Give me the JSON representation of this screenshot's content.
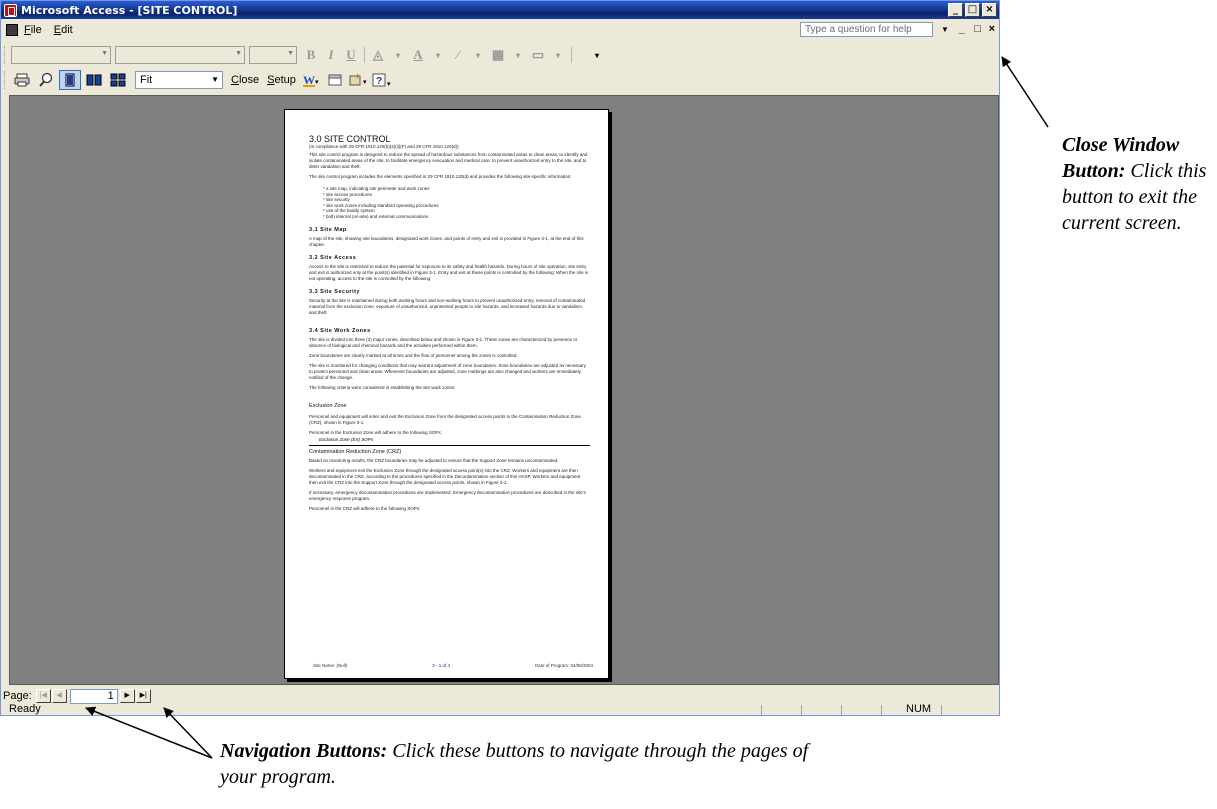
{
  "window": {
    "title": "Microsoft Access - [SITE CONTROL]",
    "minimize": "_",
    "restore": "□",
    "close": "×"
  },
  "menubar": {
    "items": [
      "File",
      "Edit"
    ],
    "help_placeholder": "Type a question for help",
    "mdi_minimize": "_",
    "mdi_restore": "□",
    "mdi_close": "×"
  },
  "formatting_toolbar": {
    "bold": "B",
    "italic": "I",
    "underline": "U"
  },
  "preview_toolbar": {
    "zoom_value": "Fit",
    "close_label": "Close",
    "setup_label": "Setup"
  },
  "document": {
    "title": "3.0  SITE CONTROL",
    "subtitle": "(In compliance with 29 CFR 1910.120(b)(4)(ii)(F) and 29 CFR 1910.120(d))",
    "intro": "This site control program is designed to reduce the spread of hazardous substances from contaminated areas to clean areas, to identify and isolate contaminated areas of the site, to facilitate emergency evacuation and medical care, to prevent unauthorized entry to the site, and to deter vandalism and theft.",
    "intro2": "The site control program includes the elements specified in 29 CFR 1910.120(d) and provides the following site-specific information:",
    "bullets": [
      "* a site map, indicating site perimeter and work zones",
      "* site access procedures",
      "* site security",
      "* site work zones including standard operating procedures",
      "* use of the buddy system",
      "* both internal (on-site) and external communications"
    ],
    "s31_head": "3.1 Site Map",
    "s31_text": "A map of the site, showing site boundaries, designated work zones, and points of entry and exit is provided in Figure 3-1, at the end of this chapter.",
    "s32_head": "3.2 Site Access",
    "s32_text": "Access to the site is restricted to reduce the potential for exposure to its safety and health hazards. During hours of site operation, site entry and exit is authorized only at the point(s) identified in Figure 3-1. Entry and exit at these points is controlled by the following: When the site is not operating, access to the site is controlled by the following:",
    "s33_head": "3.3 Site Security",
    "s33_text": "Security at the site is maintained during both working hours and non-working hours to prevent unauthorized entry, removal of contaminated material from the exclusion zone, exposure of unauthorized, unprotected people to site hazards, and increased hazards due to vandalism and theft.",
    "s34_head": "3.4 Site Work Zones",
    "s34_text": "The site is divided into three (3) major zones, described below and shown in Figure 3-1. These zones are characterized by presence or absence of biological and chemical hazards and the activities performed within them.",
    "s34_text2": "Zone boundaries are clearly marked at all times and the flow of personnel among the zones is controlled.",
    "s34_text3": "The site is monitored for changing conditions that may warrant adjustment of zone boundaries. Zone boundaries are adjusted as necessary to protect personnel and clean areas. Whenever boundaries are adjusted, zone markings are also changed and workers are immediately notified of the change.",
    "s34_text4": "The following criteria were considered in establishing the site work zones:",
    "ez_head": "Exclusion Zone",
    "ez_text": "Personnel and equipment will enter and exit the Exclusion Zone from the designated access points in the Contamination Reduction Zone (CRZ), shown in Figure 3-1.",
    "ez_text2": "Personnel in the Exclusion Zone will adhere to the following SOPs:",
    "ez_sop": "Exclusion Zone (EX) SOPs",
    "crz_head": "Contamination Reduction Zone (CRZ)",
    "crz_text": "Based on monitoring results, the CRZ boundaries may be adjusted to ensure that the Support Zone remains uncontaminated.",
    "crz_text2": "Workers and equipment exit the Exclusion Zone through the designated access point(s) into the CRZ. Workers and equipment are then decontaminated in the CRZ, according to the procedures specified in the Decontamination section of this HASP. Workers and equipment then exit the CRZ into the Support Zone through the designated access points, shown in Figure 3-1.",
    "crz_text3": "If necessary, emergency decontamination procedures are implemented. Emergency decontamination procedures are described in the site's emergency response program.",
    "crz_text4": "Personnel in the CRZ will adhere to the following SOPs:",
    "footer_left": "Site Name: (Null)",
    "footer_mid": "3 - 1 of 4",
    "footer_right": "Date of Program: 04/06/2004"
  },
  "navigation": {
    "label": "Page:",
    "first": "|◀",
    "prev": "◀",
    "current_page": "1",
    "next": "▶",
    "last": "▶|"
  },
  "statusbar": {
    "text": "Ready",
    "num": "NUM"
  },
  "annotations": {
    "close_title": "Close Window Button:",
    "close_text": "Click this button to exit the current screen.",
    "nav_title": "Navigation Buttons:",
    "nav_text": "Click these buttons to navigate through the pages of your program."
  }
}
